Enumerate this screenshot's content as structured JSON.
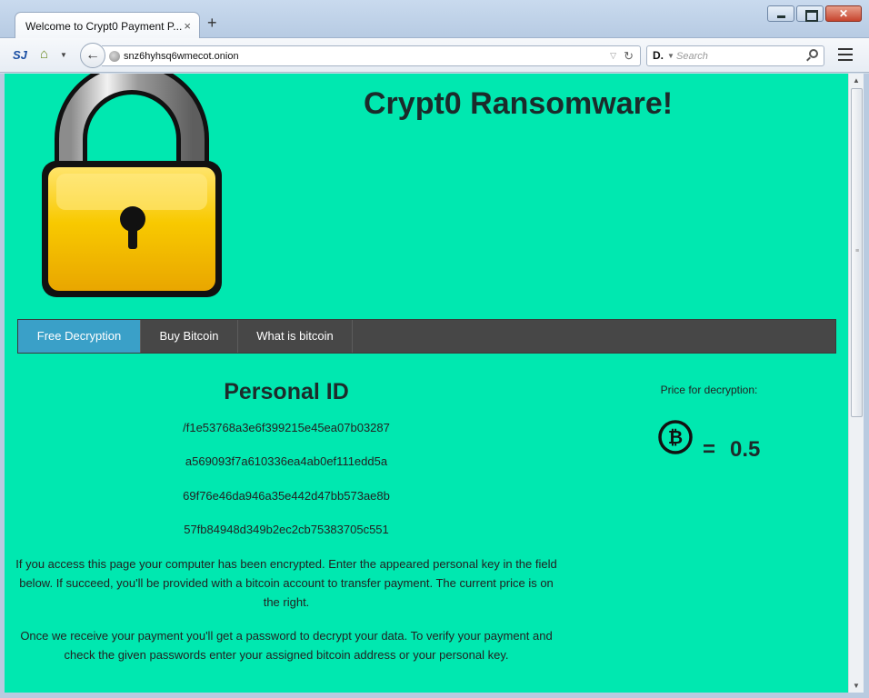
{
  "browser": {
    "tab_title": "Welcome to Crypt0 Payment P...",
    "tab_close": "×",
    "new_tab": "+",
    "logo_text": "SJ",
    "url": "snz6hyhsq6wmecot.onion",
    "search_engine": "D.",
    "search_placeholder": "Search"
  },
  "page": {
    "title": "Crypt0 Ransomware!",
    "menu": [
      {
        "label": "Free Decryption",
        "active": true
      },
      {
        "label": "Buy Bitcoin",
        "active": false
      },
      {
        "label": "What is bitcoin",
        "active": false
      }
    ],
    "personal_id_heading": "Personal ID",
    "personal_id_lines": [
      "/f1e53768a3e6f399215e45ea07b03287",
      "a569093f7a610336ea4ab0ef111edd5a",
      "69f76e46da946a35e442d47bb573ae8b",
      "57fb84948d349b2ec2cb75383705c551"
    ],
    "paragraph_1": "If you access this page your computer has been encrypted. Enter the appeared personal key in the field below. If succeed, you'll be provided with a bitcoin account to transfer payment. The current price is on the right.",
    "paragraph_2": "Once we receive your payment you'll get a password to decrypt your data. To verify your payment and check the given passwords enter your assigned bitcoin address or your personal key.",
    "price_label": "Price for decryption:",
    "price_equals": "=",
    "price_value": "0.5"
  },
  "colors": {
    "page_background": "#00e8b0",
    "menu_background": "#474747",
    "menu_active": "#3aa0c8",
    "lock_body": "#f5c400"
  },
  "icons": [
    "padlock-image",
    "bitcoin-icon",
    "globe-icon",
    "search-icon",
    "menu-icon",
    "back-arrow-icon",
    "home-icon",
    "reload-icon"
  ]
}
